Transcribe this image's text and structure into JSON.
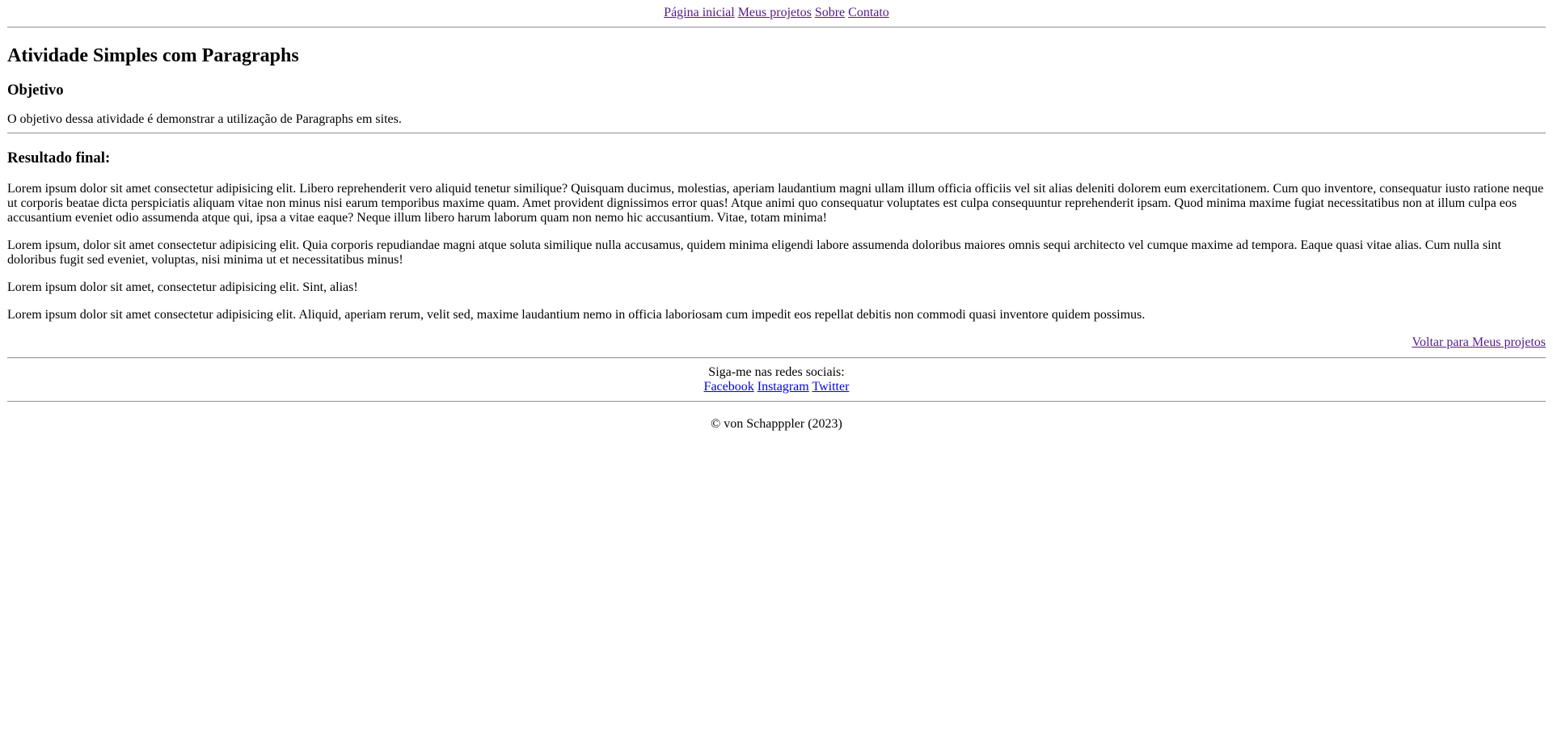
{
  "nav": {
    "items": [
      {
        "label": "Página inicial"
      },
      {
        "label": "Meus projetos"
      },
      {
        "label": "Sobre"
      },
      {
        "label": "Contato"
      }
    ]
  },
  "main": {
    "title": "Atividade Simples com Paragraphs",
    "objective_heading": "Objetivo",
    "objective_text": "O objetivo dessa atividade é demonstrar a utilização de Paragraphs em sites.",
    "result_heading": "Resultado final:",
    "paragraphs": [
      "Lorem ipsum dolor sit amet consectetur adipisicing elit. Libero reprehenderit vero aliquid tenetur similique? Quisquam ducimus, molestias, aperiam laudantium magni ullam illum officia officiis vel sit alias deleniti dolorem eum exercitationem. Cum quo inventore, consequatur iusto ratione neque ut corporis beatae dicta perspiciatis aliquam vitae non minus nisi earum temporibus maxime quam. Amet provident dignissimos error quas! Atque animi quo consequatur voluptates est culpa consequuntur reprehenderit ipsam. Quod minima maxime fugiat necessitatibus non at illum culpa eos accusantium eveniet odio assumenda atque qui, ipsa a vitae eaque? Neque illum libero harum laborum quam non nemo hic accusantium. Vitae, totam minima!",
      "Lorem ipsum, dolor sit amet consectetur adipisicing elit. Quia corporis repudiandae magni atque soluta similique nulla accusamus, quidem minima eligendi labore assumenda doloribus maiores omnis sequi architecto vel cumque maxime ad tempora. Eaque quasi vitae alias. Cum nulla sint doloribus fugit sed eveniet, voluptas, nisi minima ut et necessitatibus minus!",
      "Lorem ipsum dolor sit amet, consectetur adipisicing elit. Sint, alias!",
      "Lorem ipsum dolor sit amet consectetur adipisicing elit. Aliquid, aperiam rerum, velit sed, maxime laudantium nemo in officia laboriosam cum impedit eos repellat debitis non commodi quasi inventore quidem possimus."
    ],
    "back_link": "Voltar para Meus projetos"
  },
  "footer": {
    "follow_text": "Siga-me nas redes sociais:",
    "social": [
      {
        "label": "Facebook"
      },
      {
        "label": "Instagram"
      },
      {
        "label": "Twitter"
      }
    ],
    "copyright": "© von Schapppler (2023)"
  },
  "colors": {
    "visited_link": "#551a8b",
    "unvisited_link": "#0000ee",
    "text": "#000000",
    "background": "#ffffff"
  }
}
